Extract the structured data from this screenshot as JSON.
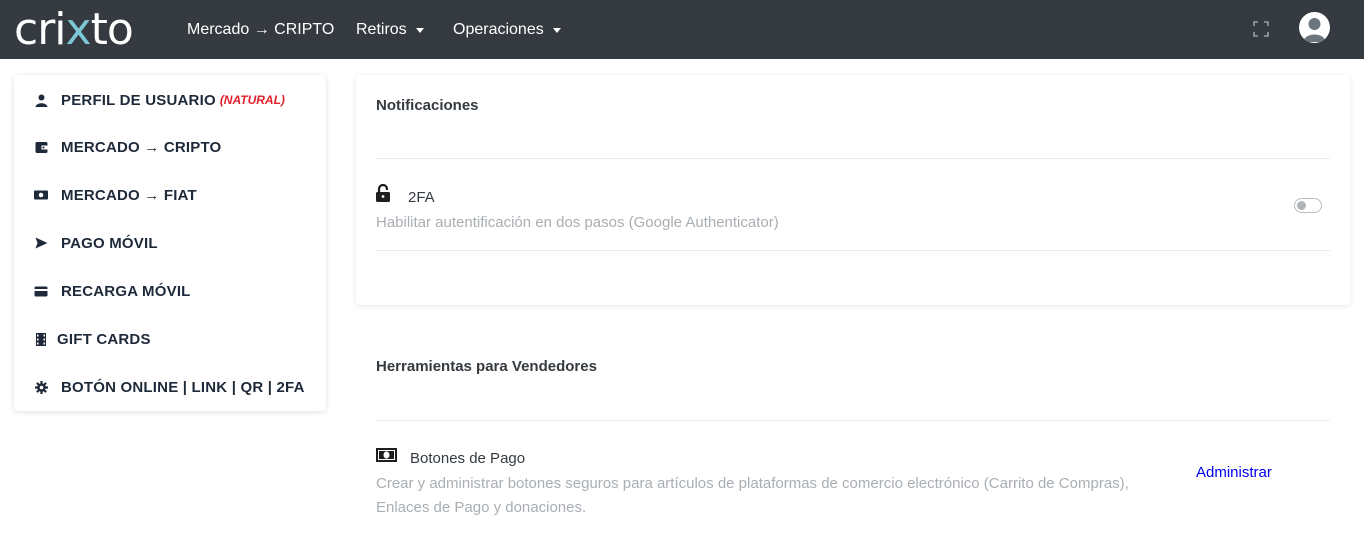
{
  "navbar": {
    "logo_left": "cri",
    "logo_x": "x",
    "logo_right": "to",
    "items": [
      {
        "label": "Mercado → CRIPTO"
      },
      {
        "label": "Retiros"
      },
      {
        "label": "Operaciones"
      }
    ],
    "icons": [
      "fullscreen-icon",
      "user-avatar-icon"
    ]
  },
  "sidebar": {
    "items": [
      {
        "label": "PERFIL DE USUARIO",
        "badge": "(NATURAL)",
        "icon": "user-icon"
      },
      {
        "label": "MERCADO → CRIPTO",
        "icon": "wallet-icon"
      },
      {
        "label": "MERCADO → FIAT",
        "icon": "money-bill-icon"
      },
      {
        "label": "PAGO MÓVIL",
        "icon": "paper-plane-icon"
      },
      {
        "label": "RECARGA MÓVIL",
        "icon": "credit-card-icon"
      },
      {
        "label": "GIFT CARDS",
        "icon": "film-icon"
      },
      {
        "label": "BOTÓN ONLINE | LINK | QR | 2FA",
        "icon": "cog-icon"
      }
    ]
  },
  "notifications": {
    "title": "Notificaciones",
    "twofa": {
      "title": "2FA",
      "description": "Habilitar autentificación en dos pasos (Google Authenticator)",
      "enabled": false,
      "icon": "lock-icon"
    }
  },
  "sellers": {
    "title": "Herramientas para Vendedores",
    "payment_buttons": {
      "title": "Botones de Pago",
      "description": "Crear y administrar botones seguros para artículos de plataformas de comercio electrónico (Carrito de Compras), Enlaces de Pago y donaciones.",
      "action": "Administrar",
      "icon": "money-bill-icon"
    }
  },
  "colors": {
    "navbar": "#343a40",
    "accent_badge": "#e3202a",
    "link": "#0000ee",
    "muted_text": "#a9aeb3"
  }
}
